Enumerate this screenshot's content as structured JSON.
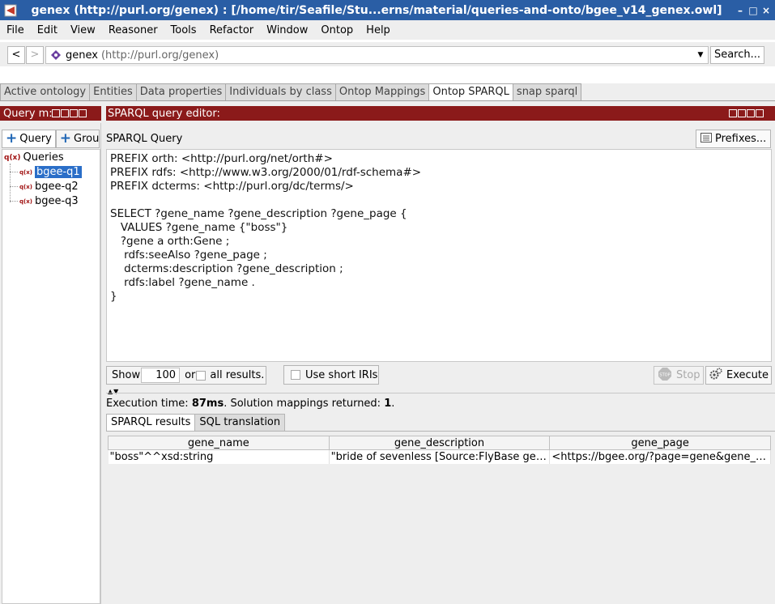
{
  "window": {
    "title": "genex (http://purl.org/genex)  : [/home/tir/Seafile/Stu...erns/material/queries-and-onto/bgee_v14_genex.owl]",
    "controls": [
      "–",
      "□",
      "×"
    ]
  },
  "menu": [
    "File",
    "Edit",
    "View",
    "Reasoner",
    "Tools",
    "Refactor",
    "Window",
    "Ontop",
    "Help"
  ],
  "nav": {
    "back": "<",
    "forward": ">",
    "ontology_name": "genex",
    "ontology_iri": "(http://purl.org/genex)",
    "search_label": "Search..."
  },
  "tabs": [
    "Active ontology",
    "Entities",
    "Data properties",
    "Individuals by class",
    "Ontop Mappings",
    "Ontop SPARQL",
    "snap sparql"
  ],
  "active_tab": "Ontop SPARQL",
  "query_manager": {
    "title": "Query m:",
    "tab_query": "Query",
    "tab_group": "Grou",
    "root": "Queries",
    "items": [
      "bgee-q1",
      "bgee-q2",
      "bgee-q3"
    ],
    "selected": "bgee-q1"
  },
  "editor": {
    "title": "SPARQL query editor:",
    "label": "SPARQL Query",
    "prefixes_button": "Prefixes...",
    "query_text": "PREFIX orth: <http://purl.org/net/orth#>\nPREFIX rdfs: <http://www.w3.org/2000/01/rdf-schema#>\nPREFIX dcterms: <http://purl.org/dc/terms/>\n\nSELECT ?gene_name ?gene_description ?gene_page {\n   VALUES ?gene_name {\"boss\"}\n   ?gene a orth:Gene ;\n    rdfs:seeAlso ?gene_page ;\n    dcterms:description ?gene_description ;\n    rdfs:label ?gene_name .\n}"
  },
  "controls": {
    "show_label": "Show",
    "limit_value": "100",
    "or_label": "or",
    "all_results_label": "all results.",
    "short_iris_label": "Use short IRIs",
    "stop_label": "Stop",
    "execute_label": "Execute",
    "stop_icon_text": "STOP"
  },
  "status": {
    "prefix": "Execution time: ",
    "time": "87ms",
    "middle": ". Solution mappings returned: ",
    "count": "1",
    "suffix": "."
  },
  "results": {
    "tabs": [
      "SPARQL results",
      "SQL translation"
    ],
    "columns": [
      "gene_name",
      "gene_description",
      "gene_page"
    ],
    "rows": [
      [
        "\"boss\"^^xsd:string",
        "\"bride of sevenless [Source:FlyBase gen...",
        "<https://bgee.org/?page=gene&gene_id..."
      ]
    ]
  },
  "colors": {
    "titlebar": "#2a5ea5",
    "view_header": "#8b1a1a",
    "selection": "#2a6ec8"
  }
}
